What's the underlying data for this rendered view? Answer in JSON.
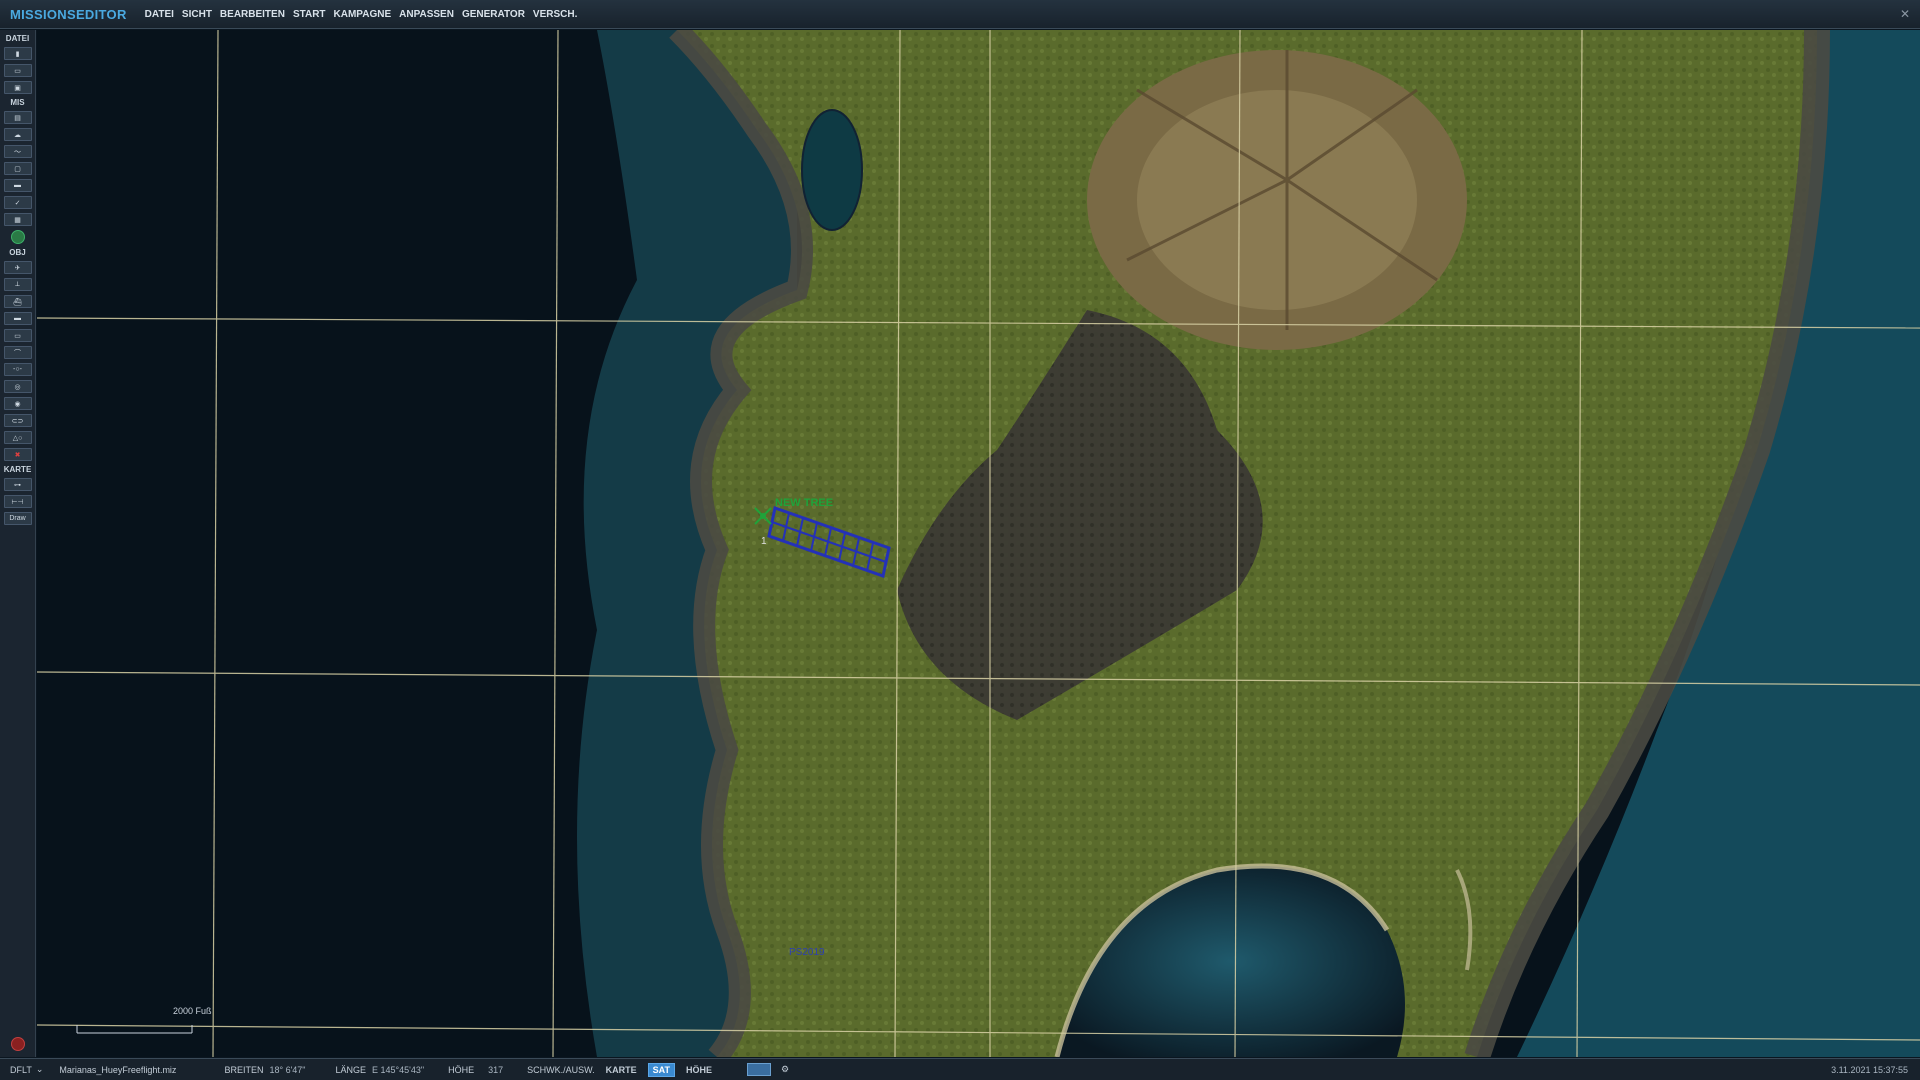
{
  "app": {
    "title": "MISSIONSEDITOR"
  },
  "menu": [
    "DATEI",
    "SICHT",
    "BEARBEITEN",
    "START",
    "KAMPAGNE",
    "ANPASSEN",
    "GENERATOR",
    "VERSCH."
  ],
  "sidebar": {
    "sections": {
      "datei": "DATEI",
      "mis": "MIS",
      "obj": "OBJ",
      "karte": "KARTE"
    },
    "draw_label": "Draw"
  },
  "map": {
    "unit_label": "NEW TREE",
    "unit_number": "1",
    "waypoint_label": "PS2019",
    "scale_label": "2000 Fuß"
  },
  "status": {
    "coalition": "DFLT",
    "filename": "Marianas_HueyFreeflight.miz",
    "lat_label": "BREITEN",
    "lat_value": "18° 6'47\"",
    "lon_label": "LÄNGE",
    "lon_value": "E 145°45'43\"",
    "alt_label": "HÖHE",
    "alt_value": "317",
    "mode_label": "SCHWK./AUSW.",
    "toggle_karte": "KARTE",
    "toggle_sat": "SAT",
    "toggle_hoehe": "HÖHE",
    "datetime": "3.11.2021 15:37:55"
  }
}
